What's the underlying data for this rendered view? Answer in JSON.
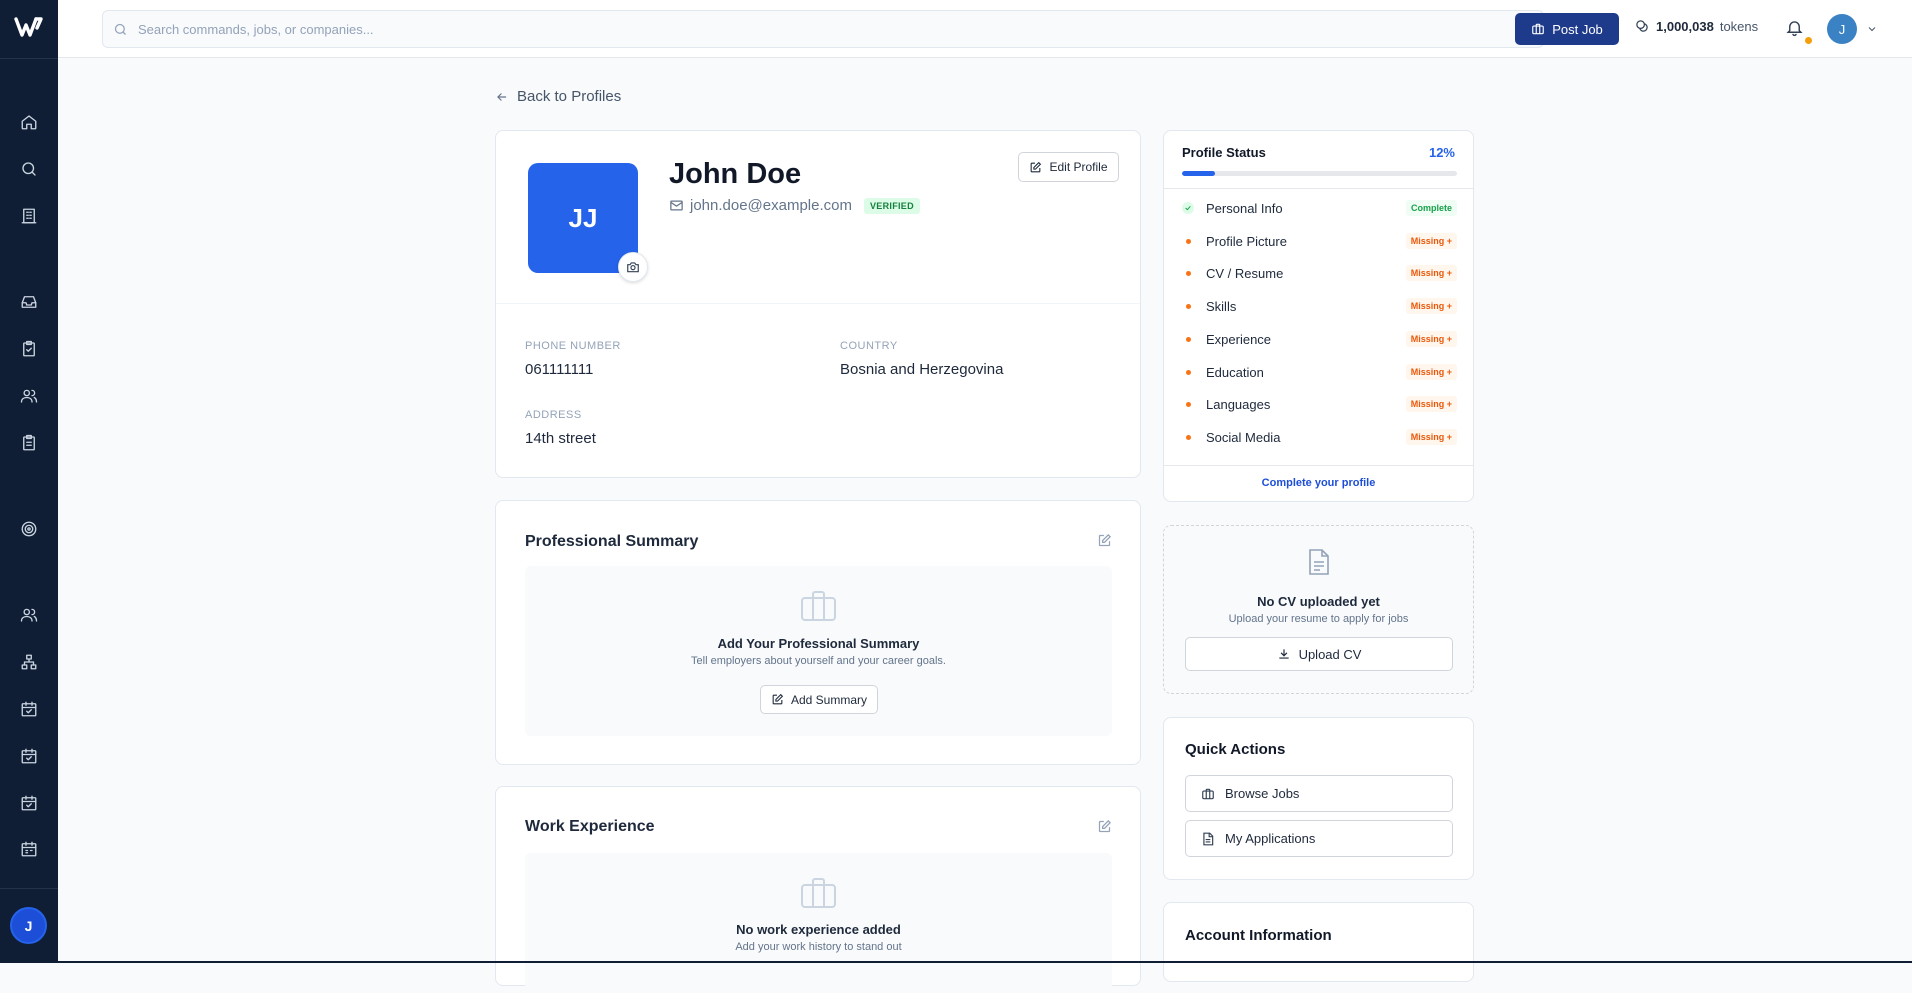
{
  "topbar": {
    "search_placeholder": "Search commands, jobs, or companies...",
    "post_job_label": "Post Job",
    "tokens_value": "1,000,038",
    "tokens_label": "tokens",
    "user_initial": "J"
  },
  "sidebar": {
    "user_initial": "J",
    "icons": [
      "home-icon",
      "search-icon",
      "building-icon",
      "inbox-icon",
      "clipboard-icon",
      "users-icon",
      "clipboard-list-icon",
      "target-icon",
      "users-icon",
      "org-chart-icon",
      "calendar-check-icon",
      "calendar-check-icon",
      "calendar-check-icon",
      "calendar-icon"
    ]
  },
  "back_label": "Back to Profiles",
  "profile": {
    "initials": "JJ",
    "name": "John Doe",
    "email": "john.doe@example.com",
    "verified_label": "VERIFIED",
    "edit_label": "Edit Profile",
    "phone_label": "PHONE NUMBER",
    "phone": "061111111",
    "country_label": "COUNTRY",
    "country": "Bosnia and Herzegovina",
    "address_label": "ADDRESS",
    "address": "14th street"
  },
  "summary": {
    "title": "Professional Summary",
    "empty_title": "Add Your Professional Summary",
    "empty_sub": "Tell employers about yourself and your career goals.",
    "button_label": "Add Summary"
  },
  "experience": {
    "title": "Work Experience",
    "empty_title": "No work experience added",
    "empty_sub": "Add your work history to stand out"
  },
  "status": {
    "title": "Profile Status",
    "percent_label": "12%",
    "percent_value": 0.12,
    "items": [
      {
        "label": "Personal Info",
        "badge": "Complete"
      },
      {
        "label": "Profile Picture",
        "badge": "Missing +"
      },
      {
        "label": "CV / Resume",
        "badge": "Missing +"
      },
      {
        "label": "Skills",
        "badge": "Missing +"
      },
      {
        "label": "Experience",
        "badge": "Missing +"
      },
      {
        "label": "Education",
        "badge": "Missing +"
      },
      {
        "label": "Languages",
        "badge": "Missing +"
      },
      {
        "label": "Social Media",
        "badge": "Missing +"
      }
    ],
    "complete_link": "Complete your profile"
  },
  "cv": {
    "title": "No CV uploaded yet",
    "subtitle": "Upload your resume to apply for jobs",
    "button_label": "Upload CV"
  },
  "quick_actions": {
    "title": "Quick Actions",
    "browse_jobs": "Browse Jobs",
    "my_applications": "My Applications"
  },
  "account_info": {
    "title": "Account Information"
  },
  "colors": {
    "sidebar": "#0f1e35",
    "accent": "#2563eb",
    "post_job": "#1e3a8a",
    "complete": "#16a34a",
    "missing": "#ea580c"
  }
}
